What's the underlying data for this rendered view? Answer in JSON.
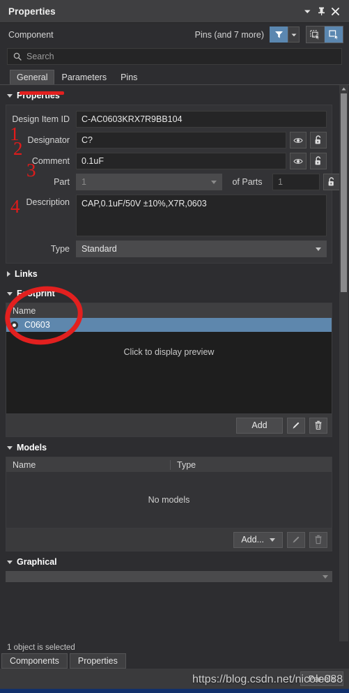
{
  "titlebar": {
    "title": "Properties",
    "icons": [
      "chevron-down-icon",
      "pin-icon",
      "close-icon"
    ]
  },
  "toolbar": {
    "object_type": "Component",
    "pins_label": "Pins (and 7 more)",
    "filter_icon": "funnel-icon",
    "filter_dropdown_icon": "chevron-down-icon",
    "select_all_icon": "select-all-icon",
    "select_touching_icon": "select-touching-icon"
  },
  "search": {
    "placeholder": "Search",
    "icon": "search-icon"
  },
  "tabs": [
    {
      "label": "General",
      "active": true
    },
    {
      "label": "Parameters",
      "active": false
    },
    {
      "label": "Pins",
      "active": false
    }
  ],
  "properties_section": {
    "title": "Properties",
    "fields": {
      "design_item_id": {
        "label": "Design Item ID",
        "value": "C-AC0603KRX7R9BB104"
      },
      "designator": {
        "label": "Designator",
        "value": "C?"
      },
      "comment": {
        "label": "Comment",
        "value": "0.1uF"
      },
      "part": {
        "label": "Part",
        "value": "1"
      },
      "of_parts": {
        "label": "of Parts",
        "value": "1"
      },
      "description": {
        "label": "Description",
        "value": "CAP,0.1uF/50V ±10%,X7R,0603"
      },
      "type": {
        "label": "Type",
        "value": "Standard"
      }
    },
    "row_icons": {
      "visibility": "eye-icon",
      "lock": "unlocked-padlock-icon"
    }
  },
  "links_section": {
    "title": "Links"
  },
  "footprint_section": {
    "title": "Footprint",
    "column_header": "Name",
    "rows": [
      {
        "name": "C0603",
        "selected": true
      }
    ],
    "preview_text": "Click to display preview",
    "buttons": {
      "add": "Add",
      "edit_icon": "pencil-icon",
      "delete_icon": "trash-icon"
    }
  },
  "models_section": {
    "title": "Models",
    "columns": [
      "Name",
      "Type"
    ],
    "empty_text": "No models",
    "buttons": {
      "add": "Add...",
      "add_caret_icon": "chevron-down-icon",
      "edit_icon": "pencil-icon",
      "delete_icon": "trash-icon"
    }
  },
  "graphical_section": {
    "title": "Graphical"
  },
  "status": {
    "text": "1 object is selected"
  },
  "bottom_tabs": [
    {
      "label": "Components"
    },
    {
      "label": "Properties"
    }
  ],
  "taskbar": {
    "panels_label": "Panels"
  },
  "annotations": {
    "numbers": [
      "1",
      "2",
      "3",
      "4"
    ],
    "underline_target": "General",
    "ellipse_target": "Footprint"
  },
  "watermark": {
    "text": "https://blog.csdn.net/nicole088"
  },
  "colors": {
    "accent_blue": "#5b87b0",
    "selection_blue": "#5e87ad",
    "annotation_red": "#e2201f",
    "panel_bg": "#2d2d30",
    "field_bg": "#252526"
  }
}
